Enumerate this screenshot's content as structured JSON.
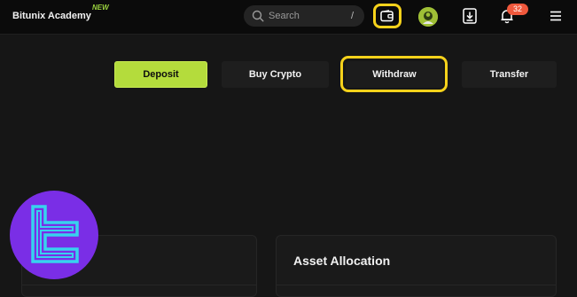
{
  "header": {
    "brand": "Bitunix Academy",
    "new_tag": "NEW",
    "search_placeholder": "Search",
    "search_shortcut": "/",
    "notification_count": "32",
    "icons": [
      "search-icon",
      "wallet-icon",
      "avatar",
      "download-icon",
      "bell-icon",
      "menu-icon"
    ]
  },
  "actions": {
    "deposit": "Deposit",
    "buy_crypto": "Buy Crypto",
    "withdraw": "Withdraw",
    "transfer": "Transfer"
  },
  "panels": {
    "asset_allocation_title": "Asset Allocation"
  },
  "colors": {
    "accent_green": "#b4dc3c",
    "highlight_yellow": "#f6d21b",
    "badge_red": "#f0583c",
    "logo_purple": "#7a2ee6",
    "logo_cyan": "#37d2ee"
  }
}
